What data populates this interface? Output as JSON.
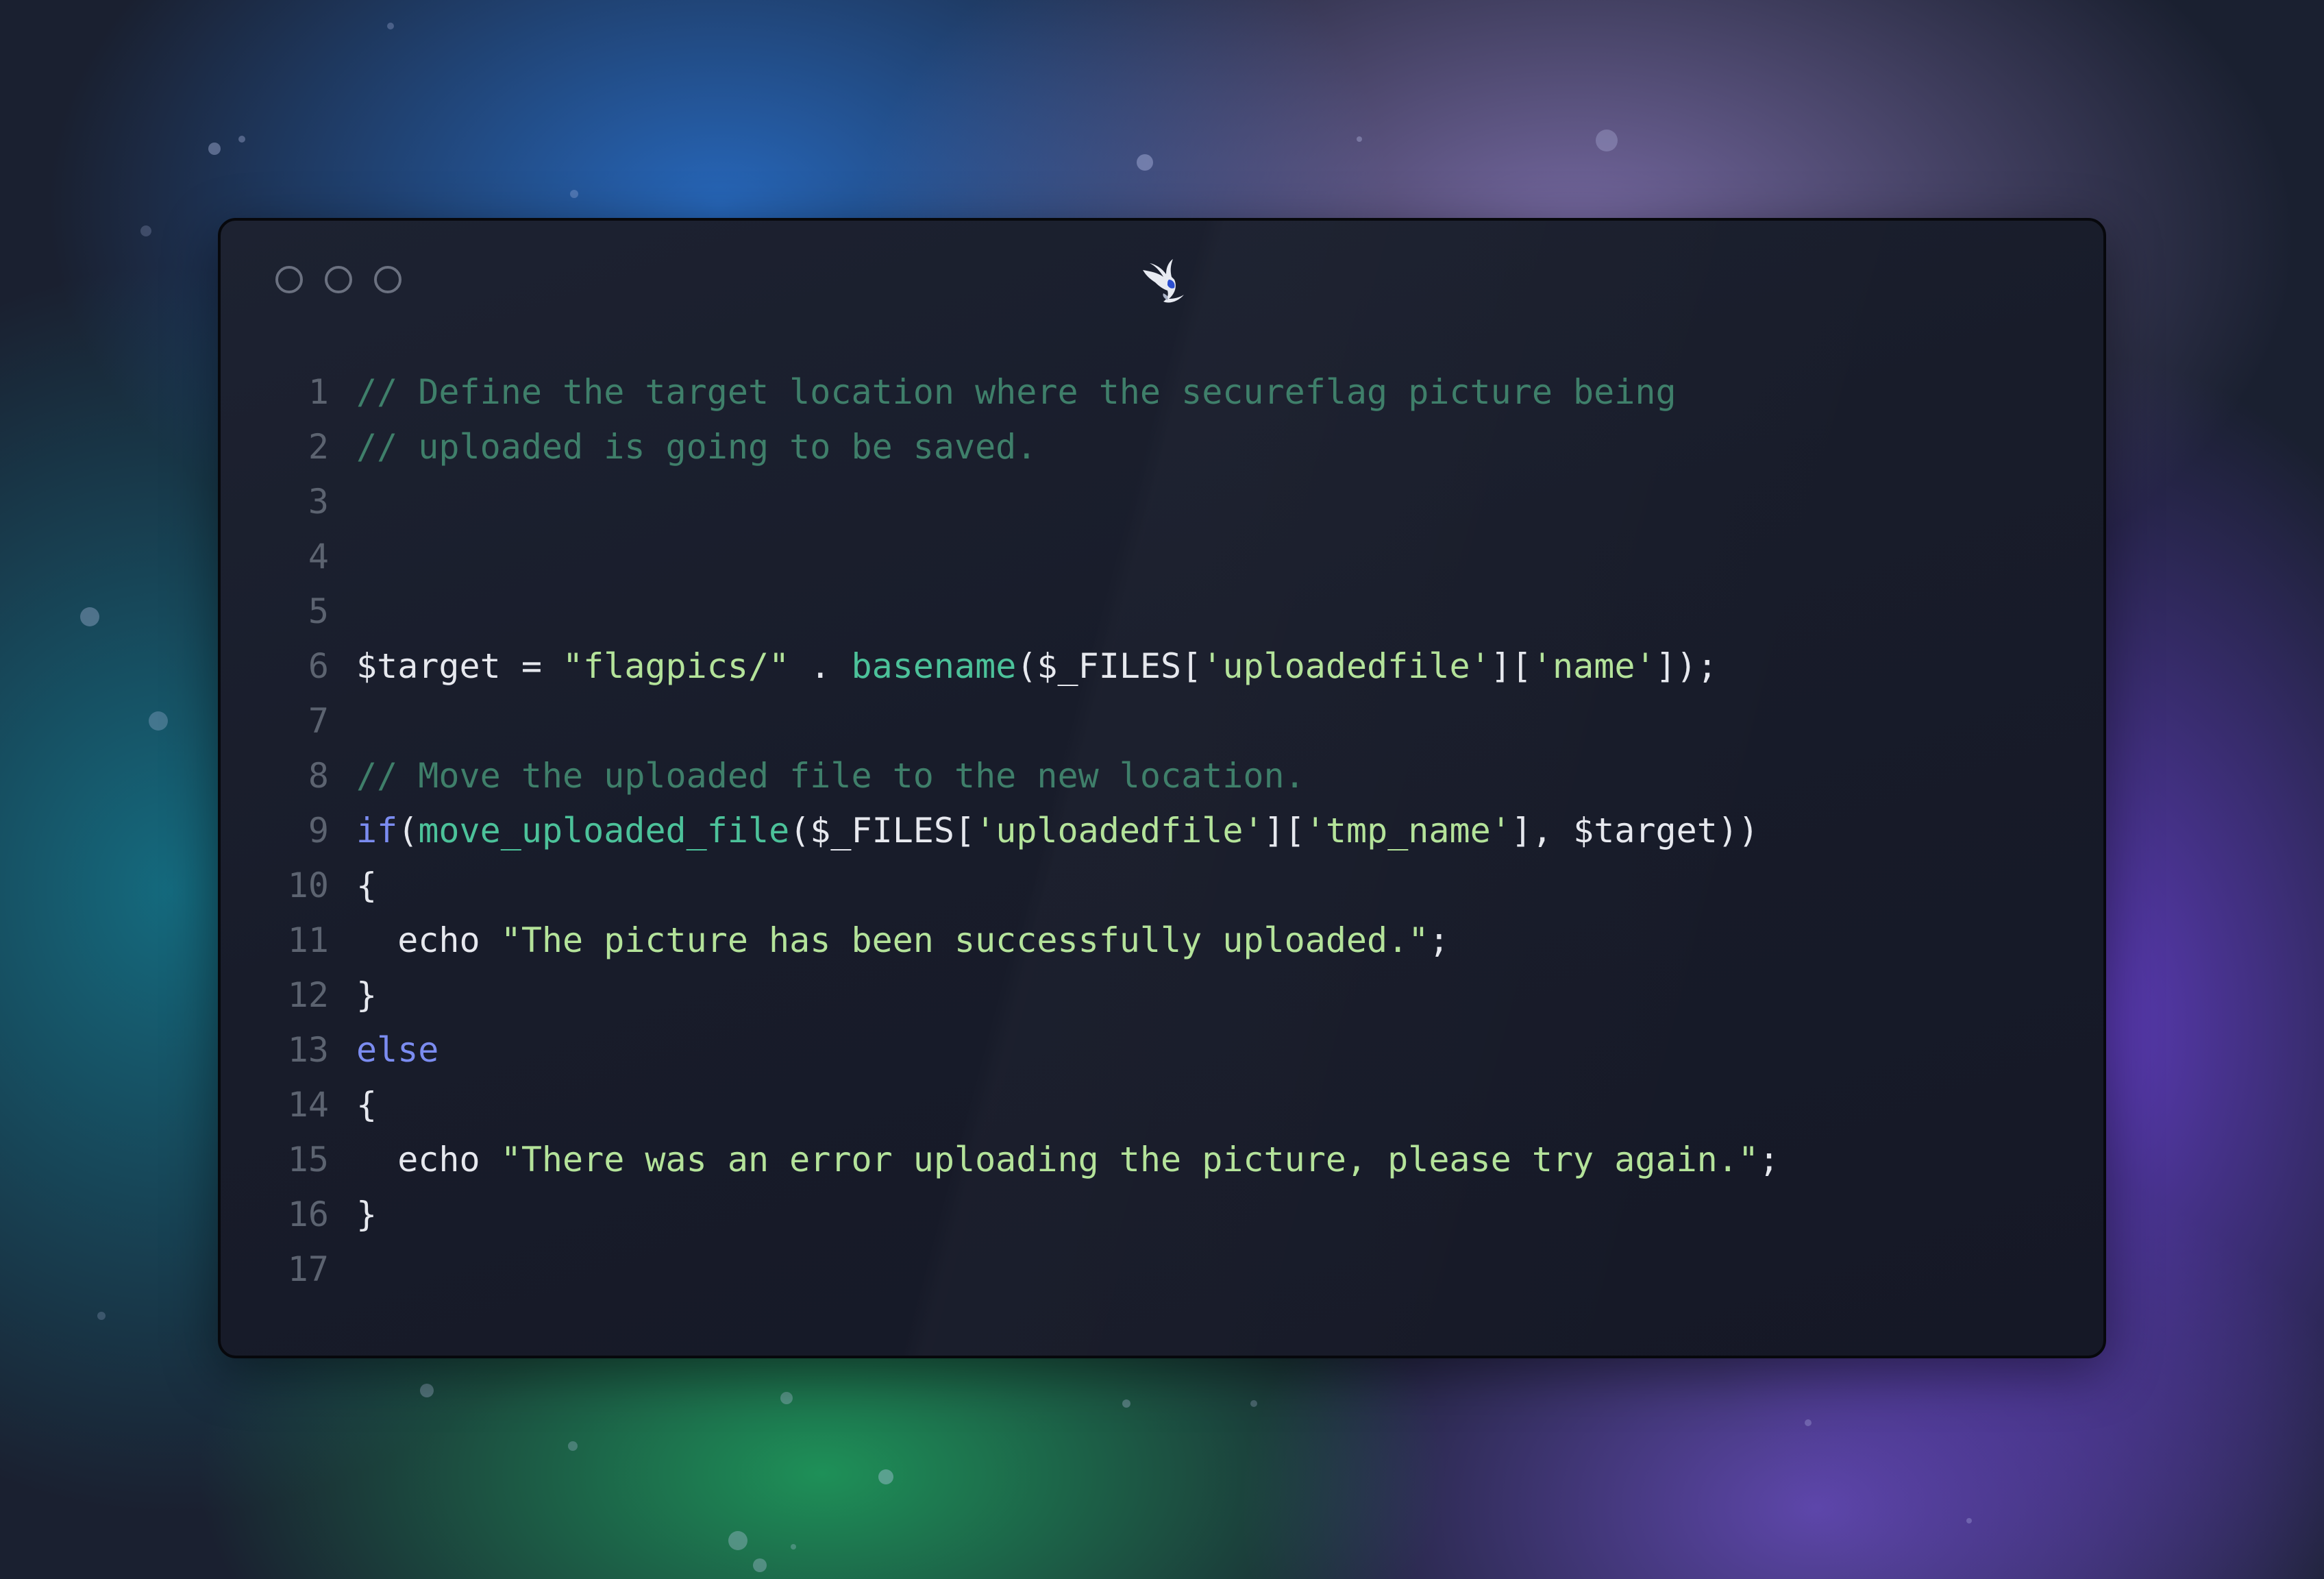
{
  "window": {
    "controls": [
      "close-button",
      "minimize-button",
      "maximize-button"
    ],
    "logo_icon": "secureflag-bird-logo-icon"
  },
  "colors": {
    "comment": "#3f7f6a",
    "keyword": "#7b8cf0",
    "function": "#4cc29a",
    "string": "#b4e39a",
    "plain": "#e6e8ee",
    "line_number": "#5c6370",
    "window_bg": "#181c2a"
  },
  "code": {
    "lines": [
      {
        "n": "1",
        "tokens": [
          {
            "t": "c-comment",
            "v": "// Define the target location where the secureflag picture being"
          }
        ]
      },
      {
        "n": "2",
        "tokens": [
          {
            "t": "c-comment",
            "v": "// uploaded is going to be saved."
          }
        ]
      },
      {
        "n": "3",
        "tokens": []
      },
      {
        "n": "4",
        "tokens": []
      },
      {
        "n": "5",
        "tokens": []
      },
      {
        "n": "6",
        "tokens": [
          {
            "t": "c-plain",
            "v": "$target = "
          },
          {
            "t": "c-str",
            "v": "\"flagpics/\""
          },
          {
            "t": "c-plain",
            "v": " . "
          },
          {
            "t": "c-fn",
            "v": "basename"
          },
          {
            "t": "c-plain",
            "v": "($_FILES["
          },
          {
            "t": "c-str",
            "v": "'uploadedfile'"
          },
          {
            "t": "c-plain",
            "v": "]["
          },
          {
            "t": "c-str",
            "v": "'name'"
          },
          {
            "t": "c-plain",
            "v": "]);"
          }
        ]
      },
      {
        "n": "7",
        "tokens": []
      },
      {
        "n": "8",
        "tokens": [
          {
            "t": "c-comment",
            "v": "// Move the uploaded file to the new location."
          }
        ]
      },
      {
        "n": "9",
        "tokens": [
          {
            "t": "c-kw",
            "v": "if"
          },
          {
            "t": "c-plain",
            "v": "("
          },
          {
            "t": "c-fn",
            "v": "move_uploaded_file"
          },
          {
            "t": "c-plain",
            "v": "($_FILES["
          },
          {
            "t": "c-str",
            "v": "'uploadedfile'"
          },
          {
            "t": "c-plain",
            "v": "]["
          },
          {
            "t": "c-str",
            "v": "'tmp_name'"
          },
          {
            "t": "c-plain",
            "v": "], $target))"
          }
        ]
      },
      {
        "n": "10",
        "tokens": [
          {
            "t": "c-plain",
            "v": "{"
          }
        ]
      },
      {
        "n": "11",
        "tokens": [
          {
            "t": "c-plain",
            "v": "  echo "
          },
          {
            "t": "c-str",
            "v": "\"The picture has been successfully uploaded.\""
          },
          {
            "t": "c-plain",
            "v": ";"
          }
        ]
      },
      {
        "n": "12",
        "tokens": [
          {
            "t": "c-plain",
            "v": "}"
          }
        ]
      },
      {
        "n": "13",
        "tokens": [
          {
            "t": "c-kw",
            "v": "else"
          }
        ]
      },
      {
        "n": "14",
        "tokens": [
          {
            "t": "c-plain",
            "v": "{"
          }
        ]
      },
      {
        "n": "15",
        "tokens": [
          {
            "t": "c-plain",
            "v": "  echo "
          },
          {
            "t": "c-str",
            "v": "\"There was an error uploading the picture, please try again.\""
          },
          {
            "t": "c-plain",
            "v": ";"
          }
        ]
      },
      {
        "n": "16",
        "tokens": [
          {
            "t": "c-plain",
            "v": "}"
          }
        ]
      },
      {
        "n": "17",
        "tokens": []
      }
    ]
  }
}
